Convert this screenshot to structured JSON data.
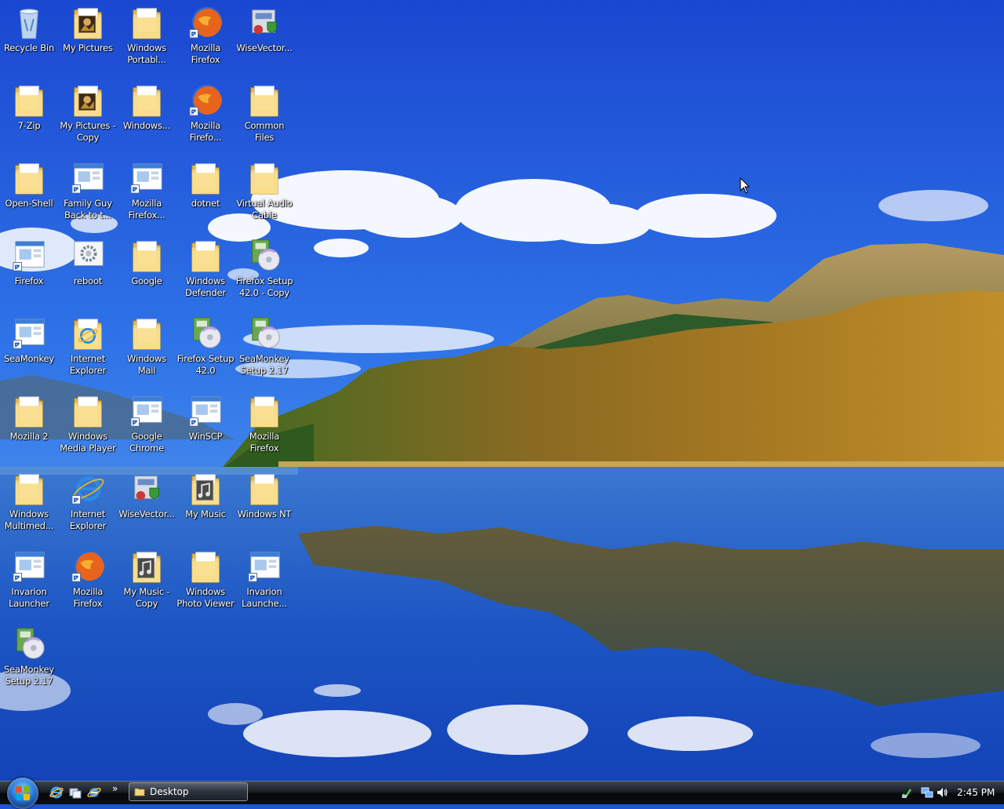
{
  "desktop": {
    "icons": [
      {
        "label": "Recycle Bin",
        "icon": "recycle-bin-icon"
      },
      {
        "label": "My Pictures",
        "icon": "pictures-folder-icon"
      },
      {
        "label": "Windows\nPortabl...",
        "icon": "folder-icon"
      },
      {
        "label": "Mozilla\nFirefox",
        "icon": "firefox-icon"
      },
      {
        "label": "WiseVector...",
        "icon": "installer-icon"
      },
      {
        "label": "7-Zip",
        "icon": "folder-icon"
      },
      {
        "label": "My Pictures -\nCopy",
        "icon": "pictures-folder-icon"
      },
      {
        "label": "Windows...",
        "icon": "folder-icon"
      },
      {
        "label": "Mozilla\nFirefo...",
        "icon": "firefox-icon"
      },
      {
        "label": "Common\nFiles",
        "icon": "folder-icon"
      },
      {
        "label": "Open-Shell",
        "icon": "folder-icon"
      },
      {
        "label": "Family Guy\nBack to t...",
        "icon": "window-shortcut-icon"
      },
      {
        "label": "Mozilla\nFirefox...",
        "icon": "window-shortcut-icon"
      },
      {
        "label": "dotnet",
        "icon": "folder-icon"
      },
      {
        "label": "Virtual Audio\nCable",
        "icon": "folder-icon"
      },
      {
        "label": "Firefox",
        "icon": "window-shortcut-icon"
      },
      {
        "label": "reboot",
        "icon": "settings-file-icon"
      },
      {
        "label": "Google",
        "icon": "folder-icon"
      },
      {
        "label": "Windows\nDefender",
        "icon": "folder-icon"
      },
      {
        "label": "Firefox Setup\n42.0 - Copy",
        "icon": "setup-icon"
      },
      {
        "label": "SeaMonkey",
        "icon": "window-shortcut-icon"
      },
      {
        "label": "Internet\nExplorer",
        "icon": "ie-folder-icon"
      },
      {
        "label": "Windows\nMail",
        "icon": "folder-icon"
      },
      {
        "label": "Firefox Setup\n42.0",
        "icon": "setup-icon"
      },
      {
        "label": "SeaMonkey\nSetup 2.17",
        "icon": "setup-icon"
      },
      {
        "label": "Mozilla 2",
        "icon": "folder-icon"
      },
      {
        "label": "Windows\nMedia Player",
        "icon": "folder-icon"
      },
      {
        "label": "Google\nChrome",
        "icon": "window-shortcut-icon"
      },
      {
        "label": "WinSCP",
        "icon": "window-shortcut-icon"
      },
      {
        "label": "Mozilla\nFirefox",
        "icon": "folder-icon"
      },
      {
        "label": "Windows\nMultimed...",
        "icon": "folder-icon"
      },
      {
        "label": "Internet\nExplorer",
        "icon": "ie-icon"
      },
      {
        "label": "WiseVector...",
        "icon": "installer-icon"
      },
      {
        "label": "My Music",
        "icon": "music-folder-icon"
      },
      {
        "label": "Windows NT",
        "icon": "folder-icon"
      },
      {
        "label": "Invarion\nLauncher",
        "icon": "window-shortcut-icon"
      },
      {
        "label": "Mozilla\nFirefox",
        "icon": "firefox-icon"
      },
      {
        "label": "My Music -\nCopy",
        "icon": "music-folder-icon"
      },
      {
        "label": "Windows\nPhoto Viewer",
        "icon": "folder-icon"
      },
      {
        "label": "Invarion\nLaunche...",
        "icon": "window-shortcut-icon"
      },
      {
        "label": "SeaMonkey\nSetup 2.17",
        "icon": "setup-icon"
      }
    ]
  },
  "taskbar": {
    "start_button": "start-orb-icon",
    "quick_launch": [
      "internet-explorer-icon",
      "switch-windows-icon",
      "ie-browser-icon"
    ],
    "quick_launch_more": "»",
    "tasks": [
      {
        "label": "Desktop",
        "icon": "folder-icon"
      }
    ],
    "tray_icons": [
      "security-icon",
      "network-icon",
      "volume-icon"
    ],
    "clock": "2:45 PM"
  },
  "colors": {
    "sky_top": "#1b4fd8",
    "sky_bottom": "#5aa6f2",
    "taskbar": "#0c0f14",
    "folder": "#f6d67a"
  }
}
